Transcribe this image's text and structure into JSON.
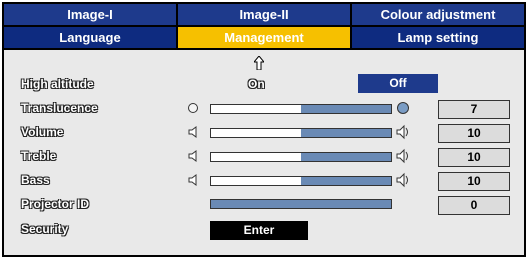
{
  "tabs_row1": [
    {
      "label": "Image-I"
    },
    {
      "label": "Image-II"
    },
    {
      "label": "Colour adjustment"
    }
  ],
  "tabs_row2": [
    {
      "label": "Language"
    },
    {
      "label": "Management",
      "active": true
    },
    {
      "label": "Lamp setting"
    }
  ],
  "settings": {
    "high_altitude": {
      "label": "High altitude",
      "on_label": "On",
      "off_label": "Off",
      "selected": "Off"
    },
    "translucence": {
      "label": "Translucence",
      "value": "7",
      "level": 0.5
    },
    "volume": {
      "label": "Volume",
      "value": "10",
      "level": 0.5
    },
    "treble": {
      "label": "Treble",
      "value": "10",
      "level": 0.5
    },
    "bass": {
      "label": "Bass",
      "value": "10",
      "level": 0.5
    },
    "projector_id": {
      "label": "Projector ID",
      "value": "0"
    },
    "security": {
      "label": "Security",
      "button_label": "Enter"
    }
  },
  "icons": {
    "cursor": "up-arrow-icon",
    "translucence_low": "circle-icon",
    "translucence_high": "circle-icon",
    "volume_low": "speaker-icon",
    "volume_high": "speaker-loud-icon"
  },
  "colors": {
    "tab_bg": "#1e3a8c",
    "active_tab": "#f6c000",
    "slider_fill": "#6a8ab5",
    "panel_bg": "#e9e9e9"
  }
}
